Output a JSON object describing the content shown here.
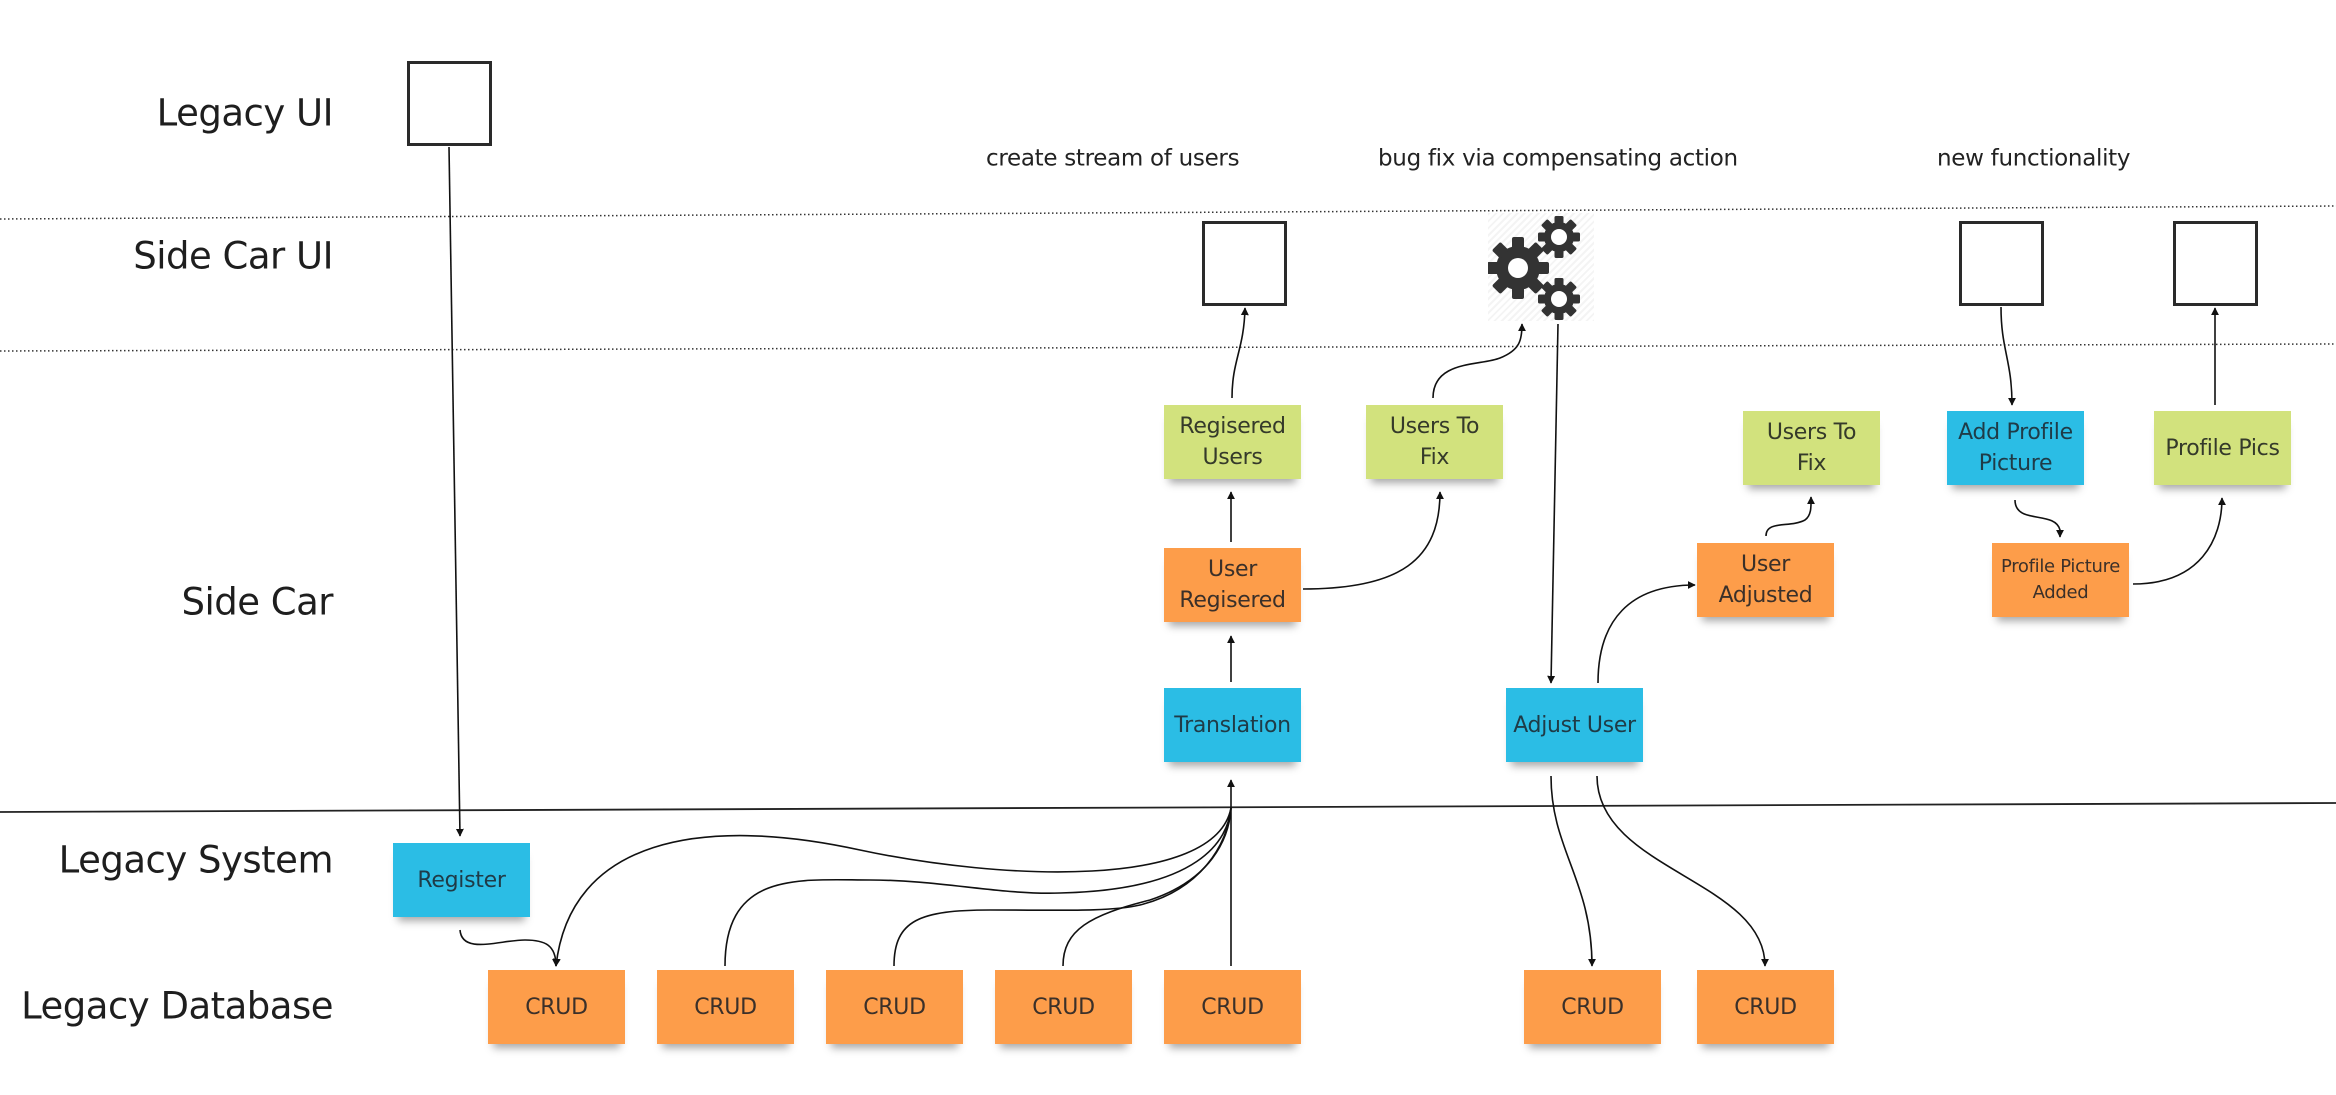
{
  "lanes": [
    {
      "id": "legacy-ui",
      "label": "Legacy UI"
    },
    {
      "id": "side-car-ui",
      "label": "Side Car UI"
    },
    {
      "id": "side-car",
      "label": "Side Car"
    },
    {
      "id": "legacy-system",
      "label": "Legacy System"
    },
    {
      "id": "legacy-database",
      "label": "Legacy Database"
    }
  ],
  "annotations": {
    "create_stream": "create stream of users",
    "bug_fix": "bug fix via compensating action",
    "new_functionality": "new functionality"
  },
  "stickies": {
    "register": {
      "label": "Register",
      "color": "blue"
    },
    "translation": {
      "label": "Translation",
      "color": "blue"
    },
    "user_registered": {
      "label": "User Regisered",
      "color": "orange"
    },
    "registered_users": {
      "label": "Regisered Users",
      "color": "green"
    },
    "users_to_fix_1": {
      "label": "Users To Fix",
      "color": "green"
    },
    "adjust_user": {
      "label": "Adjust User",
      "color": "blue"
    },
    "user_adjusted": {
      "label": "User Adjusted",
      "color": "orange"
    },
    "users_to_fix_2": {
      "label": "Users To Fix",
      "color": "green"
    },
    "add_profile_picture": {
      "label": "Add Profile Picture",
      "color": "blue"
    },
    "profile_picture_added": {
      "label": "Profile Picture Added",
      "color": "orange"
    },
    "profile_pics": {
      "label": "Profile Pics",
      "color": "green"
    },
    "crud": [
      {
        "label": "CRUD"
      },
      {
        "label": "CRUD"
      },
      {
        "label": "CRUD"
      },
      {
        "label": "CRUD"
      },
      {
        "label": "CRUD"
      },
      {
        "label": "CRUD"
      },
      {
        "label": "CRUD"
      }
    ]
  },
  "icons": {
    "gears": "gears-icon"
  },
  "colors": {
    "blue": "#2bbde5",
    "orange": "#fd9d4a",
    "green": "#d2e27d",
    "line": "#111111"
  }
}
